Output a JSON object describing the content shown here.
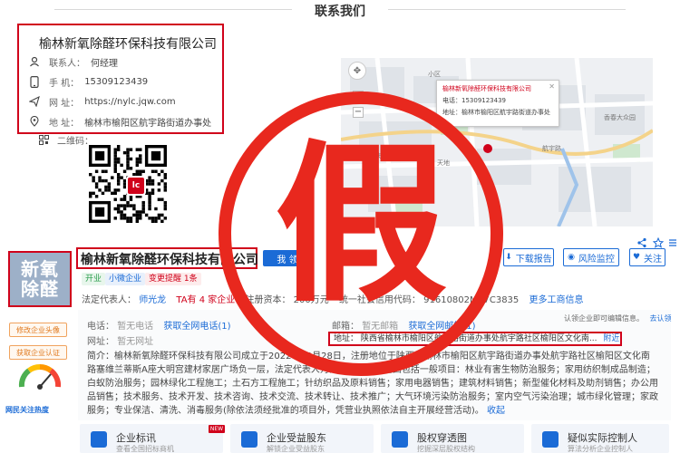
{
  "section_title": "联系我们",
  "contact": {
    "company_name": "榆林新氧除醛环保科技有限公司",
    "contact_label": "联系人：",
    "contact_value": "何经理",
    "phone_label": "手  机：",
    "phone_value": "15309123439",
    "website_label": "网  址：",
    "website_value": "https://nylc.jqw.com",
    "address_label": "地  址：",
    "address_value": "榆林市榆阳区航宇路街道办事处",
    "qr_label": "二维码："
  },
  "map": {
    "popup_title": "榆林新氧除醛环保科技有限公司",
    "popup_phone": "电话：15309123439",
    "popup_address": "地址：榆林市榆阳区航宇路街道办事处",
    "labels": [
      "小区",
      "香春大众园",
      "航宇路",
      "天地",
      "富陕"
    ]
  },
  "qr_badge": "lc",
  "profile": {
    "logo_line1": "新氧",
    "logo_line2": "除醛",
    "company_name": "榆林新氧除醛环保科技有限公司",
    "follow_label": "我  领",
    "tags": {
      "status": "开业",
      "type": "小微企业",
      "alert": "变更提醒 1条"
    },
    "actions": {
      "download": "下载报告",
      "risk": "风险监控",
      "follow": "关注"
    },
    "legal_label": "法定代表人：",
    "legal_name": "师光龙",
    "legal_extra": "TA有 4 家企业",
    "capital_label": "注册资本：",
    "capital_value": "200万元",
    "credit_label": "统一社会信用代码：",
    "credit_value": "91610802MA7C3835",
    "more_info": "更多工商信息",
    "side_btn_1": "修改企业头像",
    "side_btn_2": "获取企业认证",
    "gauge_label": "网民关注热度",
    "phone_label": "电话：",
    "phone_value": "暂无电话",
    "phone_link": "获取全网电话(1)",
    "email_label": "邮箱：",
    "email_value": "暂无邮箱",
    "email_link": "获取全网邮箱(1)",
    "website_label": "网址：",
    "website_value": "暂无网址",
    "address_label": "地址：",
    "address_value": "陕西省榆林市榆阳区航宇路街道办事处航宇路社区榆阳区文化南...",
    "address_link": "附近公司",
    "auth_note": "认领企业即可编辑信息。",
    "auth_link": "去认领",
    "intro_label": "简介：",
    "intro_text": "榆林新氧除醛环保科技有限公司成立于2022年03月28日，注册地位于陕西省榆林市榆阳区航宇路街道办事处航宇路社区榆阳区文化南路塞维兰蒂斯A座大明宫建材家居广场负一层，法定代表人为师光龙。经营范围包括一般项目：林业有害生物防治服务；家用纺织制成品制造；白蚁防治服务；园林绿化工程施工；土石方工程施工；针纺织品及原料销售；家用电器销售；建筑材料销售；新型催化材料及助剂销售；办公用品销售；技术服务、技术开发、技术咨询、技术交流、技术转让、技术推广；大气环境污染防治服务；室内空气污染治理；城市绿化管理；家政服务；专业保洁、清洗、消毒服务(除依法须经批准的项目外，凭营业执照依法自主开展经营活动)。",
    "intro_link": "收起",
    "cards": [
      {
        "title": "企业标讯",
        "sub": "查看全国招标商机"
      },
      {
        "title": "企业受益股东",
        "sub": "解锁企业受益股东"
      },
      {
        "title": "股权穿透图",
        "sub": "挖掘深层股权结构"
      },
      {
        "title": "疑似实际控制人",
        "sub": "算法分析企业控制人"
      }
    ],
    "new_badge": "NEW"
  },
  "stamp_char": "假",
  "colors": {
    "accent_red": "#d0021b",
    "link_blue": "#1b6bd6",
    "stamp_red": "#e8281e"
  }
}
